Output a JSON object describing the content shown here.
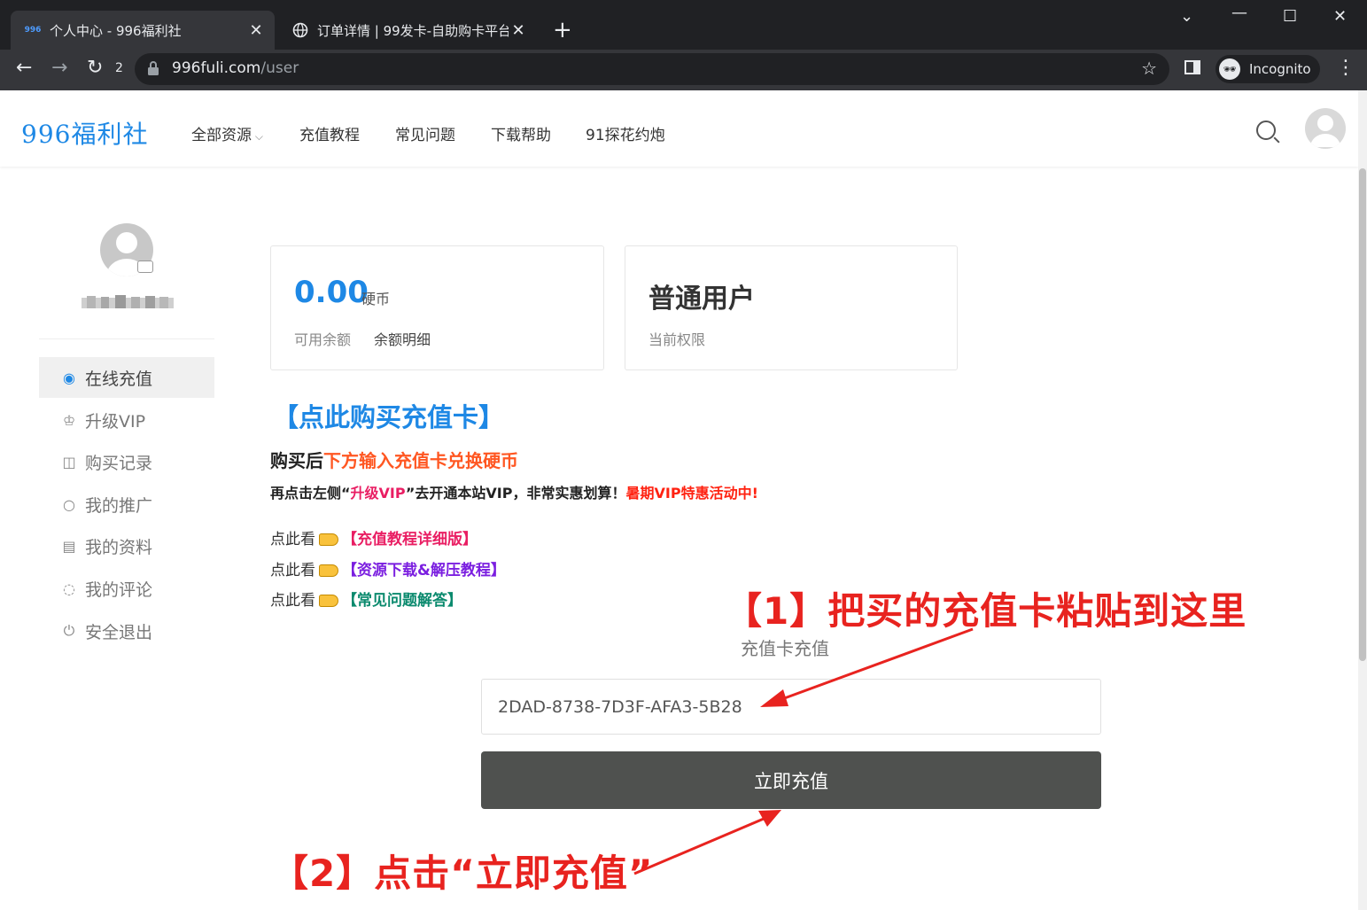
{
  "browser": {
    "tabs": [
      {
        "favicon": "996",
        "title": "个人中心 - 996福利社",
        "active": true
      },
      {
        "favicon": "globe-icon",
        "title": "订单详情 | 99发卡-自助购卡平台",
        "active": false
      }
    ],
    "reload_badge": "2",
    "url_host": "996fuli.com",
    "url_path": "/user",
    "incognito_label": "Incognito"
  },
  "site": {
    "logo": "996福利社",
    "nav": [
      "全部资源",
      "充值教程",
      "常见问题",
      "下载帮助",
      "91探花约炮"
    ]
  },
  "sidebar": {
    "items": [
      {
        "icon": "yen-circle-icon",
        "label": "在线充值",
        "active": true
      },
      {
        "icon": "crown-icon",
        "label": "升级VIP"
      },
      {
        "icon": "bag-icon",
        "label": "购买记录"
      },
      {
        "icon": "circle-icon",
        "label": "我的推广"
      },
      {
        "icon": "profile-card-icon",
        "label": "我的资料"
      },
      {
        "icon": "comment-icon",
        "label": "我的评论"
      },
      {
        "icon": "power-icon",
        "label": "安全退出"
      }
    ]
  },
  "balance_card": {
    "amount": "0.00",
    "unit": "硬币",
    "label": "可用余额",
    "detail_link": "余额明细"
  },
  "role_card": {
    "role": "普通用户",
    "label": "当前权限"
  },
  "promo": {
    "buy_link": "【点此购买充值卡】",
    "line1_a": "购买后",
    "line1_b": "下方输入充值卡兑换硬币",
    "line2_a": "再点击左侧“",
    "line2_b": "升级VIP",
    "line2_c": "”去开通本站VIP，非常实惠划算！",
    "line2_d": "暑期VIP特惠活动中!",
    "links": [
      {
        "prefix": "点此看",
        "label": "【充值教程详细版】",
        "color": "#e91e63"
      },
      {
        "prefix": "点此看",
        "label": "【资源下载&解压教程】",
        "color": "#7b1fe0"
      },
      {
        "prefix": "点此看",
        "label": "【常见问题解答】",
        "color": "#0b8a6e"
      }
    ]
  },
  "form": {
    "title": "充值卡充值",
    "card_value": "2DAD-8738-7D3F-AFA3-5B28",
    "submit_label": "立即充值"
  },
  "annotations": {
    "step1": "【1】把买的充值卡粘贴到这里",
    "step2": "【2】点击“立即充值”",
    "color": "#e8231f"
  }
}
